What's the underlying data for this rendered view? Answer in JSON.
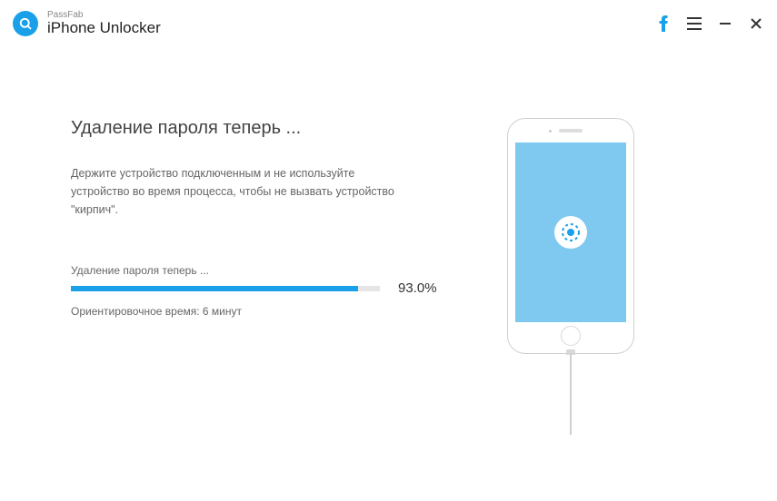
{
  "header": {
    "brand": "PassFab",
    "app_name": "iPhone Unlocker"
  },
  "main": {
    "heading": "Удаление пароля теперь ...",
    "subtext": "Держите устройство подключенным и не используйте устройство во время процесса, чтобы не вызвать устройство \"кирпич\".",
    "progress_label": "Удаление пароля теперь ...",
    "progress_percent": 93.0,
    "progress_percent_display": "93.0%",
    "eta": "Ориентировочное время: 6 минут"
  },
  "colors": {
    "accent": "#1aa0e8"
  }
}
